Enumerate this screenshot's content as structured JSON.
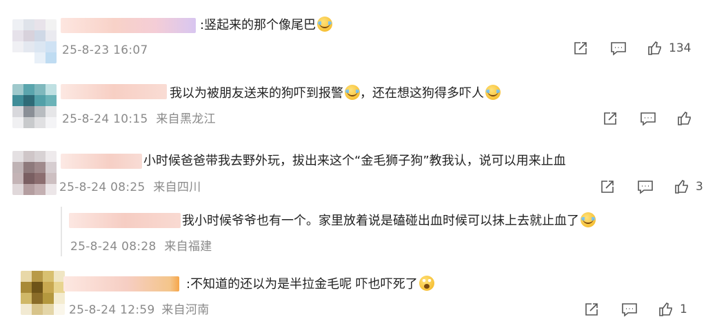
{
  "comments": [
    {
      "text": ":竖起来的那个像尾巴",
      "emoji": "crying-laughing",
      "time": "25-8-23 16:07",
      "location": "",
      "likes": "134"
    },
    {
      "text": "我以为被朋友送来的狗吓到报警",
      "text2": "，还在想这狗得多吓人",
      "emoji": "crying-laughing",
      "time": "25-8-24 10:15",
      "location": "来自黑龙江",
      "likes": ""
    },
    {
      "text": "小时候爸爸带我去野外玩，拔出来这个“金毛狮子狗”教我认，说可以用来止血",
      "time": "25-8-24 08:25",
      "location": "来自四川",
      "likes": "3"
    },
    {
      "text": "我小时候爷爷也有一个。家里放着说是磕碰出血时候可以抹上去就止血了",
      "emoji": "crying-laughing",
      "time": "25-8-24 08:28",
      "location": "来自福建",
      "likes": ""
    },
    {
      "text": ":不知道的还以为是半拉金毛呢 吓也吓死了",
      "emoji": "shocked",
      "time": "25-8-24 12:59",
      "location": "来自河南",
      "likes": "1"
    }
  ],
  "icons": {
    "share": "share-icon",
    "comment": "comment-icon",
    "like": "thumbs-up-icon"
  },
  "colors": {
    "meta_text": "#8a8a8a",
    "body_text": "#222222",
    "blur_name": "#f6cfc6"
  }
}
